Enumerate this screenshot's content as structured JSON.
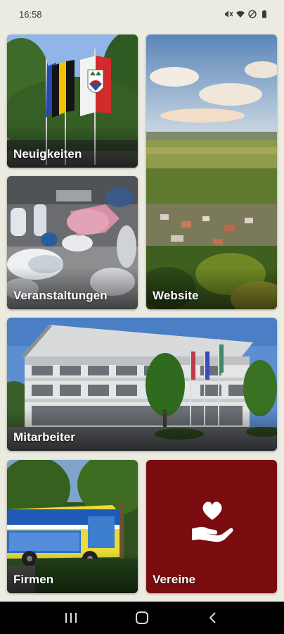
{
  "status_bar": {
    "time": "16:58",
    "icons": [
      "mute-icon",
      "wifi-icon",
      "dnd-icon",
      "battery-icon"
    ]
  },
  "tiles": {
    "news": {
      "label": "Neuigkeiten"
    },
    "events": {
      "label": "Veranstaltungen"
    },
    "website": {
      "label": "Website"
    },
    "staff": {
      "label": "Mitarbeiter"
    },
    "firms": {
      "label": "Firmen"
    },
    "clubs": {
      "label": "Vereine",
      "icon": "heart-hand-icon"
    }
  },
  "nav_bar": {
    "buttons": [
      "recents-icon",
      "home-icon",
      "back-icon"
    ]
  },
  "colors": {
    "background": "#ebebe1",
    "clubs_tile": "#7a0b0f",
    "nav_bar": "#000000"
  }
}
